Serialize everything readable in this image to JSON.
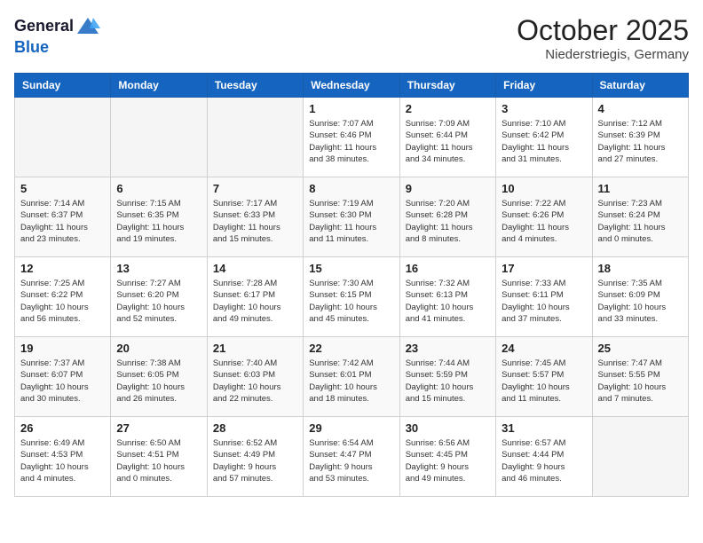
{
  "header": {
    "logo_line1": "General",
    "logo_line2": "Blue",
    "month": "October 2025",
    "location": "Niederstriegis, Germany"
  },
  "weekdays": [
    "Sunday",
    "Monday",
    "Tuesday",
    "Wednesday",
    "Thursday",
    "Friday",
    "Saturday"
  ],
  "weeks": [
    [
      {
        "day": "",
        "info": ""
      },
      {
        "day": "",
        "info": ""
      },
      {
        "day": "",
        "info": ""
      },
      {
        "day": "1",
        "info": "Sunrise: 7:07 AM\nSunset: 6:46 PM\nDaylight: 11 hours\nand 38 minutes."
      },
      {
        "day": "2",
        "info": "Sunrise: 7:09 AM\nSunset: 6:44 PM\nDaylight: 11 hours\nand 34 minutes."
      },
      {
        "day": "3",
        "info": "Sunrise: 7:10 AM\nSunset: 6:42 PM\nDaylight: 11 hours\nand 31 minutes."
      },
      {
        "day": "4",
        "info": "Sunrise: 7:12 AM\nSunset: 6:39 PM\nDaylight: 11 hours\nand 27 minutes."
      }
    ],
    [
      {
        "day": "5",
        "info": "Sunrise: 7:14 AM\nSunset: 6:37 PM\nDaylight: 11 hours\nand 23 minutes."
      },
      {
        "day": "6",
        "info": "Sunrise: 7:15 AM\nSunset: 6:35 PM\nDaylight: 11 hours\nand 19 minutes."
      },
      {
        "day": "7",
        "info": "Sunrise: 7:17 AM\nSunset: 6:33 PM\nDaylight: 11 hours\nand 15 minutes."
      },
      {
        "day": "8",
        "info": "Sunrise: 7:19 AM\nSunset: 6:30 PM\nDaylight: 11 hours\nand 11 minutes."
      },
      {
        "day": "9",
        "info": "Sunrise: 7:20 AM\nSunset: 6:28 PM\nDaylight: 11 hours\nand 8 minutes."
      },
      {
        "day": "10",
        "info": "Sunrise: 7:22 AM\nSunset: 6:26 PM\nDaylight: 11 hours\nand 4 minutes."
      },
      {
        "day": "11",
        "info": "Sunrise: 7:23 AM\nSunset: 6:24 PM\nDaylight: 11 hours\nand 0 minutes."
      }
    ],
    [
      {
        "day": "12",
        "info": "Sunrise: 7:25 AM\nSunset: 6:22 PM\nDaylight: 10 hours\nand 56 minutes."
      },
      {
        "day": "13",
        "info": "Sunrise: 7:27 AM\nSunset: 6:20 PM\nDaylight: 10 hours\nand 52 minutes."
      },
      {
        "day": "14",
        "info": "Sunrise: 7:28 AM\nSunset: 6:17 PM\nDaylight: 10 hours\nand 49 minutes."
      },
      {
        "day": "15",
        "info": "Sunrise: 7:30 AM\nSunset: 6:15 PM\nDaylight: 10 hours\nand 45 minutes."
      },
      {
        "day": "16",
        "info": "Sunrise: 7:32 AM\nSunset: 6:13 PM\nDaylight: 10 hours\nand 41 minutes."
      },
      {
        "day": "17",
        "info": "Sunrise: 7:33 AM\nSunset: 6:11 PM\nDaylight: 10 hours\nand 37 minutes."
      },
      {
        "day": "18",
        "info": "Sunrise: 7:35 AM\nSunset: 6:09 PM\nDaylight: 10 hours\nand 33 minutes."
      }
    ],
    [
      {
        "day": "19",
        "info": "Sunrise: 7:37 AM\nSunset: 6:07 PM\nDaylight: 10 hours\nand 30 minutes."
      },
      {
        "day": "20",
        "info": "Sunrise: 7:38 AM\nSunset: 6:05 PM\nDaylight: 10 hours\nand 26 minutes."
      },
      {
        "day": "21",
        "info": "Sunrise: 7:40 AM\nSunset: 6:03 PM\nDaylight: 10 hours\nand 22 minutes."
      },
      {
        "day": "22",
        "info": "Sunrise: 7:42 AM\nSunset: 6:01 PM\nDaylight: 10 hours\nand 18 minutes."
      },
      {
        "day": "23",
        "info": "Sunrise: 7:44 AM\nSunset: 5:59 PM\nDaylight: 10 hours\nand 15 minutes."
      },
      {
        "day": "24",
        "info": "Sunrise: 7:45 AM\nSunset: 5:57 PM\nDaylight: 10 hours\nand 11 minutes."
      },
      {
        "day": "25",
        "info": "Sunrise: 7:47 AM\nSunset: 5:55 PM\nDaylight: 10 hours\nand 7 minutes."
      }
    ],
    [
      {
        "day": "26",
        "info": "Sunrise: 6:49 AM\nSunset: 4:53 PM\nDaylight: 10 hours\nand 4 minutes."
      },
      {
        "day": "27",
        "info": "Sunrise: 6:50 AM\nSunset: 4:51 PM\nDaylight: 10 hours\nand 0 minutes."
      },
      {
        "day": "28",
        "info": "Sunrise: 6:52 AM\nSunset: 4:49 PM\nDaylight: 9 hours\nand 57 minutes."
      },
      {
        "day": "29",
        "info": "Sunrise: 6:54 AM\nSunset: 4:47 PM\nDaylight: 9 hours\nand 53 minutes."
      },
      {
        "day": "30",
        "info": "Sunrise: 6:56 AM\nSunset: 4:45 PM\nDaylight: 9 hours\nand 49 minutes."
      },
      {
        "day": "31",
        "info": "Sunrise: 6:57 AM\nSunset: 4:44 PM\nDaylight: 9 hours\nand 46 minutes."
      },
      {
        "day": "",
        "info": ""
      }
    ]
  ]
}
